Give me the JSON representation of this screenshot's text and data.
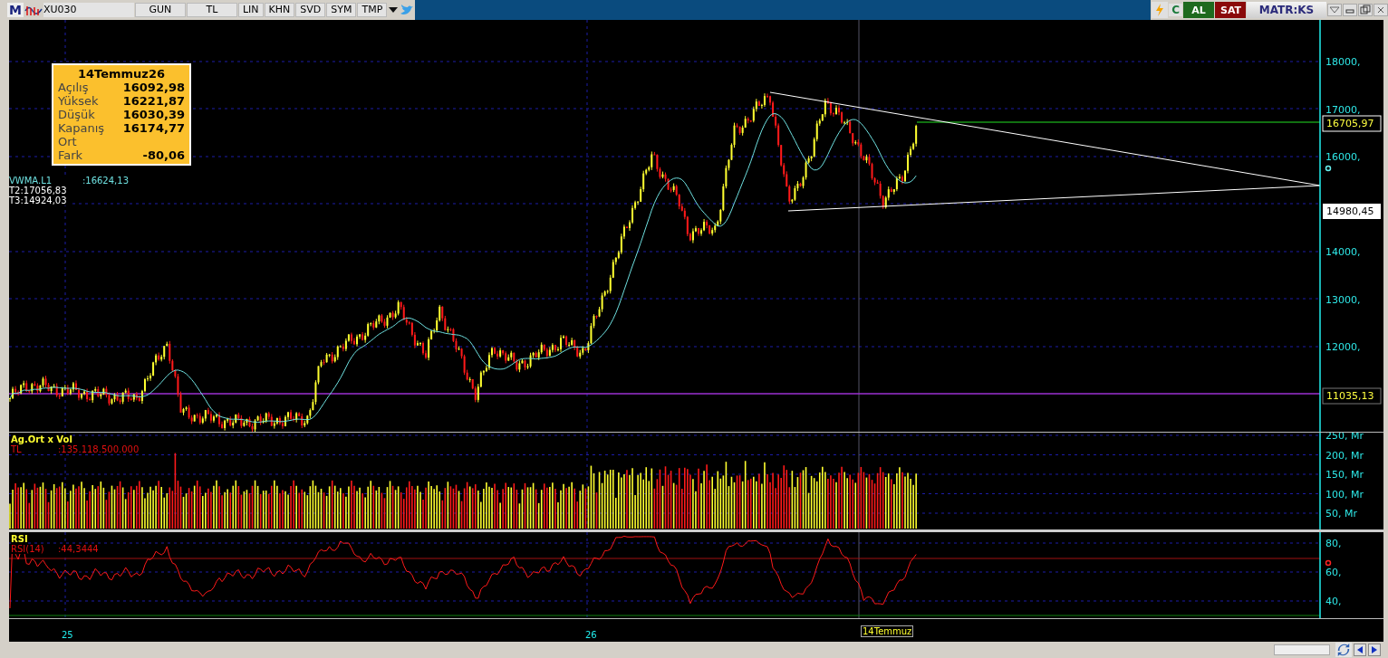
{
  "toolbar": {
    "logo": "M",
    "symbol": "XU030",
    "buttons": [
      "GUN",
      "TL",
      "LIN",
      "KHN",
      "SVD",
      "SYM",
      "TMP"
    ],
    "refresh": "C",
    "buy": "AL",
    "sell": "SAT",
    "brand": "MATR:KS"
  },
  "info_box": {
    "title": "14Temmuz26",
    "rows": [
      {
        "label": "Açılış",
        "value": "16092,98"
      },
      {
        "label": "Yüksek",
        "value": "16221,87"
      },
      {
        "label": "Düşük",
        "value": "16030,39"
      },
      {
        "label": "Kapanış",
        "value": "16174,77"
      },
      {
        "label": "Ort"
      },
      {
        "label": "Fark",
        "value": "-80,06"
      }
    ]
  },
  "price_panel": {
    "legend": [
      {
        "name": "VWMA.L1",
        "value": ":16624,13"
      },
      {
        "name": "T2:17056,83"
      },
      {
        "name": "T3:14924,03"
      }
    ],
    "yticks": [
      "18000,",
      "17000,",
      "16000,",
      "14000,",
      "13000,",
      "12000,"
    ],
    "tags": [
      {
        "text": "16705,97",
        "kind": "last"
      },
      {
        "text": "14980,45",
        "kind": "cursor"
      },
      {
        "text": "11035,13",
        "kind": "level"
      }
    ]
  },
  "volume_panel": {
    "title": "Ag.Ort x Vol",
    "unit": "TL",
    "value": ":135.118.500.000",
    "yticks": [
      "250, Mr",
      "200, Mr",
      "150, Mr",
      "100, Mr",
      "50, Mr"
    ]
  },
  "rsi_panel": {
    "title": "RSI",
    "name": "RSI(14)",
    "value": ":44,3444",
    "yticks": [
      "80,",
      "60,",
      "40,"
    ]
  },
  "x_axis": {
    "labels": [
      "25",
      "26"
    ],
    "cursor": "14Temmuz"
  }
}
